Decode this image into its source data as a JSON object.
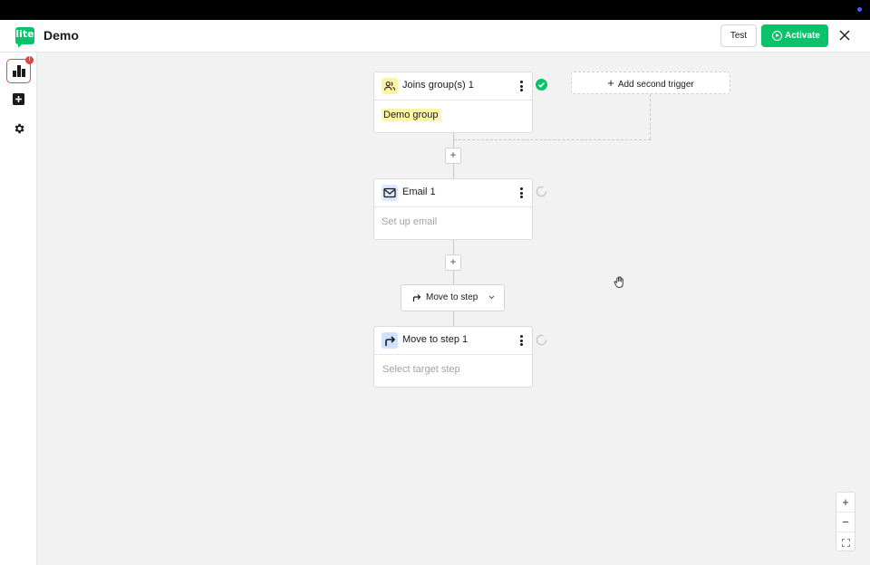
{
  "header": {
    "logo_text": "lite",
    "title": "Demo",
    "test_label": "Test",
    "activate_label": "Activate",
    "brand_color": "#09c269"
  },
  "sidebar": {
    "items": [
      {
        "icon": "bar-chart-icon",
        "badge": "!"
      },
      {
        "icon": "plus-square-icon"
      },
      {
        "icon": "gear-icon"
      }
    ]
  },
  "workflow": {
    "trigger": {
      "title": "Joins group(s) 1",
      "value": "Demo group",
      "icon": "users-icon",
      "status": "complete"
    },
    "add_trigger_label": "Add second trigger",
    "email": {
      "title": "Email 1",
      "placeholder": "Set up email",
      "icon": "mail-icon",
      "status": "pending"
    },
    "move_button_label": "Move to step",
    "move_step": {
      "title": "Move to step 1",
      "placeholder": "Select target step",
      "icon": "redirect-arrow-icon",
      "status": "pending"
    },
    "plus_label": "+"
  },
  "zoom": {
    "in": "+",
    "out": "−"
  }
}
